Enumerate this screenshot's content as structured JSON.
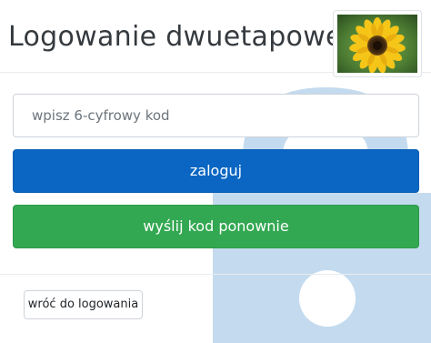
{
  "header": {
    "title": "Logowanie dwuetapowe"
  },
  "form": {
    "code_placeholder": "wpisz 6-cyfrowy kod",
    "code_value": "",
    "login_label": "zaloguj",
    "resend_label": "wyślij kod ponownie"
  },
  "footer": {
    "back_label": "wróć do logowania"
  },
  "icons": {
    "background": "padlock-icon",
    "avatar": "sunflower-image"
  },
  "colors": {
    "login_button": "#0a66c2",
    "resend_button": "#33a852",
    "padlock": "#c4dbef"
  }
}
